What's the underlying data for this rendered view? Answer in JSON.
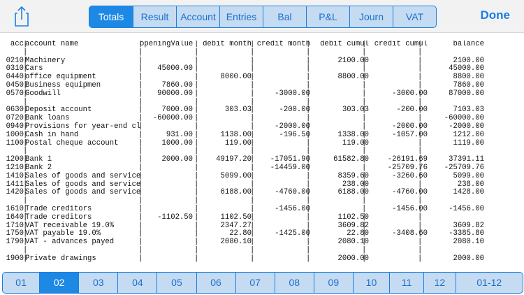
{
  "toolbar": {
    "tabs": [
      "Totals",
      "Result",
      "Account",
      "Entries",
      "Bal",
      "P&L",
      "Journ",
      "VAT"
    ],
    "active_tab": "Totals",
    "done_label": "Done",
    "share_icon": "share-icon"
  },
  "table": {
    "header": [
      "acc",
      "account name",
      "openingValue",
      "debit month",
      "credit month",
      "debit cumul",
      "credit cumul",
      "balance"
    ],
    "rows": [
      [
        "0210",
        "Machinery",
        "",
        "",
        "",
        "2100.00",
        "",
        "2100.00"
      ],
      [
        "0310",
        "Cars",
        "45000.00",
        "",
        "",
        "",
        "",
        "45000.00"
      ],
      [
        "0440",
        "office equipment",
        "",
        "8000.00",
        "",
        "8800.00",
        "",
        "8800.00"
      ],
      [
        "0450",
        "Business equipmen",
        "7860.00",
        "",
        "",
        "",
        "",
        "7860.00"
      ],
      [
        "0570",
        "Goodwill",
        "90000.00",
        "",
        "-3000.00",
        "",
        "-3000.00",
        "87000.00"
      ],
      [],
      [
        "0630",
        "Deposit account",
        "7000.00",
        "303.03",
        "-200.00",
        "303.03",
        "-200.00",
        "7103.03"
      ],
      [
        "0720",
        "Bank loans",
        "-60000.00",
        "",
        "",
        "",
        "",
        "-60000.00"
      ],
      [
        "0940",
        "Provisions for year-end cl",
        "",
        "",
        "-2000.00",
        "",
        "-2000.00",
        "-2000.00"
      ],
      [
        "1000",
        "Cash in hand",
        "931.00",
        "1138.00",
        "-196.50",
        "1338.00",
        "-1057.00",
        "1212.00"
      ],
      [
        "1100",
        "Postal cheque account",
        "1000.00",
        "119.00",
        "",
        "119.00",
        "",
        "1119.00"
      ],
      [],
      [
        "1200",
        "Bank 1",
        "2000.00",
        "49197.20",
        "-17051.90",
        "61582.80",
        "-26191.69",
        "37391.11"
      ],
      [
        "1210",
        "Bank 2",
        "",
        "",
        "-14459.00",
        "",
        "-25709.76",
        "-25709.76"
      ],
      [
        "1410",
        "Sales of goods and service",
        "",
        "5099.00",
        "",
        "8359.60",
        "-3260.60",
        "5099.00"
      ],
      [
        "1411",
        "Sales of goods and service",
        "",
        "",
        "",
        "238.00",
        "",
        "238.00"
      ],
      [
        "1420",
        "Sales of goods and service",
        "",
        "6188.00",
        "-4760.00",
        "6188.00",
        "-4760.00",
        "1428.00"
      ],
      [],
      [
        "1610",
        "Trade creditors",
        "",
        "",
        "-1456.00",
        "",
        "-1456.00",
        "-1456.00"
      ],
      [
        "1640",
        "Trade creditors",
        "-1102.50",
        "1102.50",
        "",
        "1102.50",
        "",
        ""
      ],
      [
        "1710",
        "VAT receivable 19.0%",
        "",
        "2347.27",
        "",
        "3609.82",
        "",
        "3609.82"
      ],
      [
        "1750",
        "VAT payable 19.0%",
        "",
        "22.80",
        "-1425.00",
        "22.80",
        "-3408.60",
        "-3385.80"
      ],
      [
        "1790",
        "VAT - advances payed",
        "",
        "2080.10",
        "",
        "2080.10",
        "",
        "2080.10"
      ],
      [],
      [
        "1900",
        "Private drawings",
        "",
        "",
        "",
        "2000.00",
        "",
        "2000.00"
      ]
    ]
  },
  "months": {
    "items": [
      "01",
      "02",
      "03",
      "04",
      "05",
      "06",
      "07",
      "08",
      "09",
      "10",
      "11",
      "12",
      "01-12"
    ],
    "active": "02"
  },
  "colors": {
    "accent": "#1e88e5",
    "segment_bg": "#c5dbf1",
    "toolbar_bg": "#f2f2f2"
  }
}
